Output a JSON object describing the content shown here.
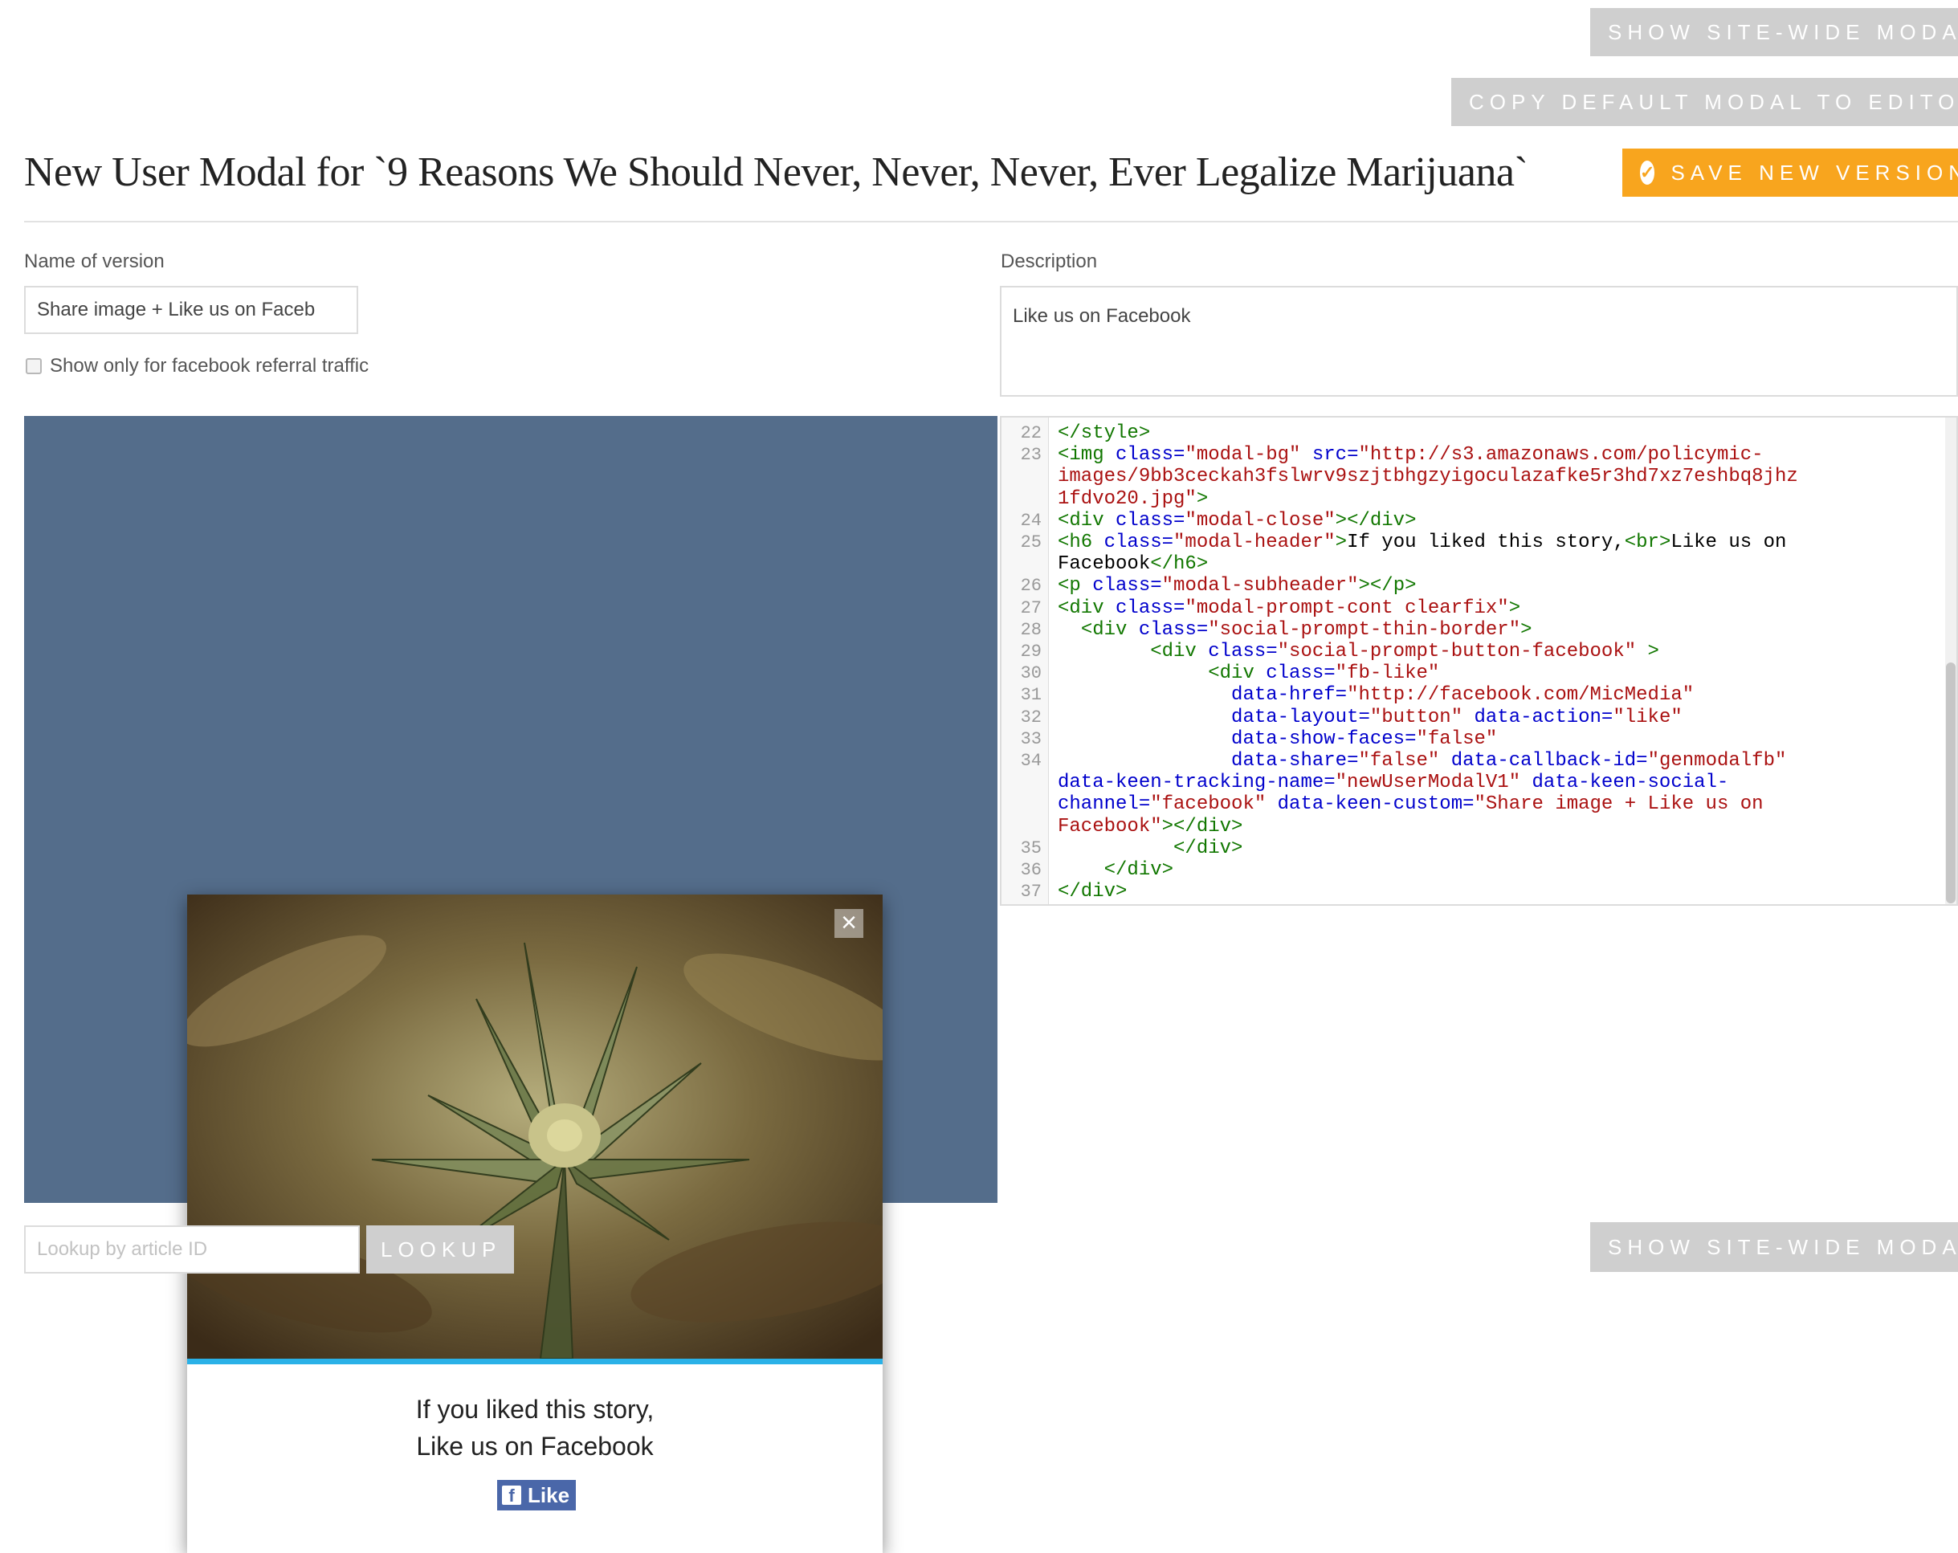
{
  "buttons": {
    "show_site_wide_top": "SHOW SITE-WIDE MODAL",
    "copy_default": "COPY DEFAULT MODAL TO EDITOR",
    "save_new_version": "SAVE NEW VERSION",
    "lookup": "LOOKUP",
    "show_site_wide_bottom": "SHOW SITE-WIDE MODAL"
  },
  "page_title": "New User Modal for `9 Reasons We Should Never, Never, Never, Ever Legalize Marijuana`",
  "form": {
    "name_label": "Name of version",
    "name_value": "Share image + Like us on Faceb",
    "checkbox_label": "Show only for facebook referral traffic",
    "description_label": "Description",
    "description_value": "Like us on Facebook"
  },
  "preview": {
    "close_symbol": "×",
    "header_line1": "If you liked this story,",
    "header_line2": "Like us on Facebook",
    "fb_like_label": "Like",
    "fb_icon": "f"
  },
  "lookup": {
    "placeholder": "Lookup by article ID"
  },
  "editor": {
    "lines": [
      {
        "n": "22",
        "segments": [
          [
            "t-tag",
            "</style>"
          ]
        ]
      },
      {
        "n": "23",
        "segments": [
          [
            "t-tag",
            "<img "
          ],
          [
            "t-attr",
            "class="
          ],
          [
            "t-str",
            "\"modal-bg\""
          ],
          [
            "t-attr",
            " src="
          ],
          [
            "t-str",
            "\"http://s3.amazonaws.com/policymic-"
          ]
        ]
      },
      {
        "n": "",
        "segments": [
          [
            "t-str",
            "images/9bb3ceckah3fslwrv9szjtbhgzyigoculazafke5r3hd7xz7eshbq8jhz"
          ]
        ]
      },
      {
        "n": "",
        "segments": [
          [
            "t-str",
            "1fdvo20.jpg\""
          ],
          [
            "t-tag",
            ">"
          ]
        ]
      },
      {
        "n": "24",
        "segments": [
          [
            "t-tag",
            "<div "
          ],
          [
            "t-attr",
            "class="
          ],
          [
            "t-str",
            "\"modal-close\""
          ],
          [
            "t-tag",
            "></div>"
          ]
        ]
      },
      {
        "n": "25",
        "segments": [
          [
            "t-tag",
            "<h6 "
          ],
          [
            "t-attr",
            "class="
          ],
          [
            "t-str",
            "\"modal-header\""
          ],
          [
            "t-tag",
            ">"
          ],
          [
            "t-txt",
            "If you liked this story,"
          ],
          [
            "t-tag",
            "<br>"
          ],
          [
            "t-txt",
            "Like us on"
          ]
        ]
      },
      {
        "n": "",
        "segments": [
          [
            "t-txt",
            "Facebook"
          ],
          [
            "t-tag",
            "</h6>"
          ]
        ]
      },
      {
        "n": "26",
        "segments": [
          [
            "t-tag",
            "<p "
          ],
          [
            "t-attr",
            "class="
          ],
          [
            "t-str",
            "\"modal-subheader\""
          ],
          [
            "t-tag",
            "></p>"
          ]
        ]
      },
      {
        "n": "27",
        "segments": [
          [
            "t-tag",
            "<div "
          ],
          [
            "t-attr",
            "class="
          ],
          [
            "t-str",
            "\"modal-prompt-cont clearfix\""
          ],
          [
            "t-tag",
            ">"
          ]
        ]
      },
      {
        "n": "28",
        "segments": [
          [
            "t-txt",
            "  "
          ],
          [
            "t-tag",
            "<div "
          ],
          [
            "t-attr",
            "class="
          ],
          [
            "t-str",
            "\"social-prompt-thin-border\""
          ],
          [
            "t-tag",
            ">"
          ]
        ]
      },
      {
        "n": "29",
        "segments": [
          [
            "t-txt",
            "        "
          ],
          [
            "t-tag",
            "<div "
          ],
          [
            "t-attr",
            "class="
          ],
          [
            "t-str",
            "\"social-prompt-button-facebook\""
          ],
          [
            "t-tag",
            " >"
          ]
        ]
      },
      {
        "n": "30",
        "segments": [
          [
            "t-txt",
            "             "
          ],
          [
            "t-tag",
            "<div "
          ],
          [
            "t-attr",
            "class="
          ],
          [
            "t-str",
            "\"fb-like\""
          ]
        ]
      },
      {
        "n": "31",
        "segments": [
          [
            "t-txt",
            "               "
          ],
          [
            "t-attr",
            "data-href="
          ],
          [
            "t-str",
            "\"http://facebook.com/MicMedia\""
          ]
        ]
      },
      {
        "n": "32",
        "segments": [
          [
            "t-txt",
            "               "
          ],
          [
            "t-attr",
            "data-layout="
          ],
          [
            "t-str",
            "\"button\""
          ],
          [
            "t-attr",
            " data-action="
          ],
          [
            "t-str",
            "\"like\""
          ]
        ]
      },
      {
        "n": "33",
        "segments": [
          [
            "t-txt",
            "               "
          ],
          [
            "t-attr",
            "data-show-faces="
          ],
          [
            "t-str",
            "\"false\""
          ]
        ]
      },
      {
        "n": "34",
        "segments": [
          [
            "t-txt",
            "               "
          ],
          [
            "t-attr",
            "data-share="
          ],
          [
            "t-str",
            "\"false\""
          ],
          [
            "t-attr",
            " data-callback-id="
          ],
          [
            "t-str",
            "\"genmodalfb\""
          ]
        ]
      },
      {
        "n": "",
        "segments": [
          [
            "t-attr",
            "data-keen-tracking-name="
          ],
          [
            "t-str",
            "\"newUserModalV1\""
          ],
          [
            "t-attr",
            " data-keen-social-"
          ]
        ]
      },
      {
        "n": "",
        "segments": [
          [
            "t-attr",
            "channel="
          ],
          [
            "t-str",
            "\"facebook\""
          ],
          [
            "t-attr",
            " data-keen-custom="
          ],
          [
            "t-str",
            "\"Share image + Like us on"
          ]
        ]
      },
      {
        "n": "",
        "segments": [
          [
            "t-str",
            "Facebook\""
          ],
          [
            "t-tag",
            "></div>"
          ]
        ]
      },
      {
        "n": "35",
        "segments": [
          [
            "t-txt",
            "          "
          ],
          [
            "t-tag",
            "</div>"
          ]
        ]
      },
      {
        "n": "36",
        "segments": [
          [
            "t-txt",
            "    "
          ],
          [
            "t-tag",
            "</div>"
          ]
        ]
      },
      {
        "n": "37",
        "segments": [
          [
            "t-tag",
            "</div>"
          ]
        ]
      }
    ]
  }
}
